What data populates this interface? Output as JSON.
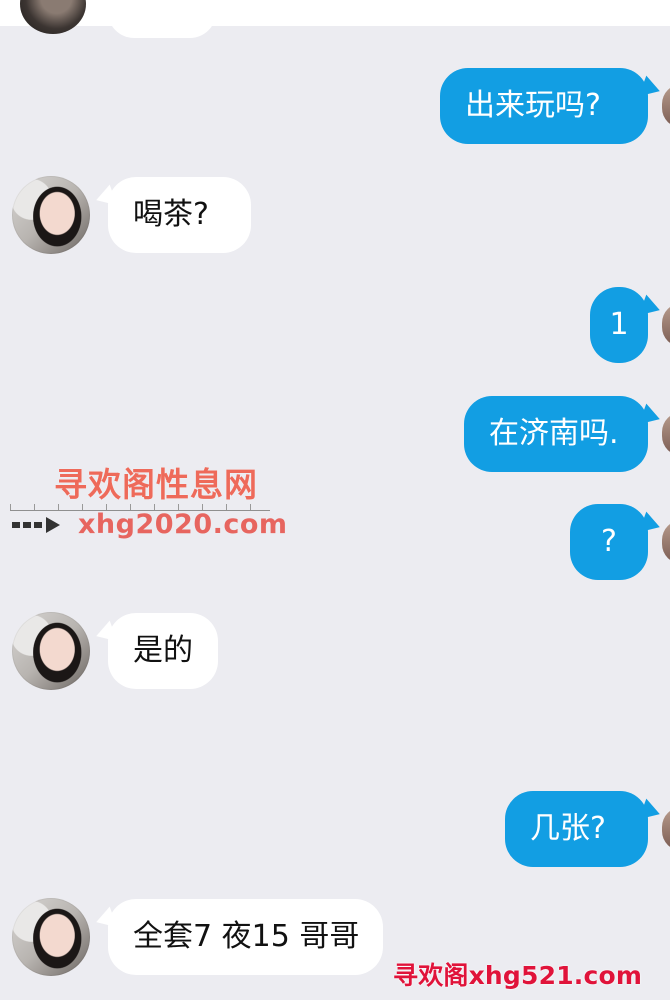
{
  "messages": [
    {
      "side": "out",
      "text": "出来玩吗?"
    },
    {
      "side": "in",
      "text": "喝茶?"
    },
    {
      "side": "out",
      "text": "1"
    },
    {
      "side": "out",
      "text": "在济南吗."
    },
    {
      "side": "out",
      "text": "?"
    },
    {
      "side": "in",
      "text": "是的"
    },
    {
      "side": "out",
      "text": "几张?"
    },
    {
      "side": "in",
      "text": "全套7 夜15 哥哥"
    }
  ],
  "watermarks": {
    "site_name": "寻欢阁性息网",
    "site_url": "xhg2020.com",
    "footer": "寻欢阁xhg521.com"
  },
  "colors": {
    "background": "#ececf1",
    "incoming_bubble": "#ffffff",
    "outgoing_bubble": "#129ee3",
    "watermark_red": "#e0133a"
  }
}
